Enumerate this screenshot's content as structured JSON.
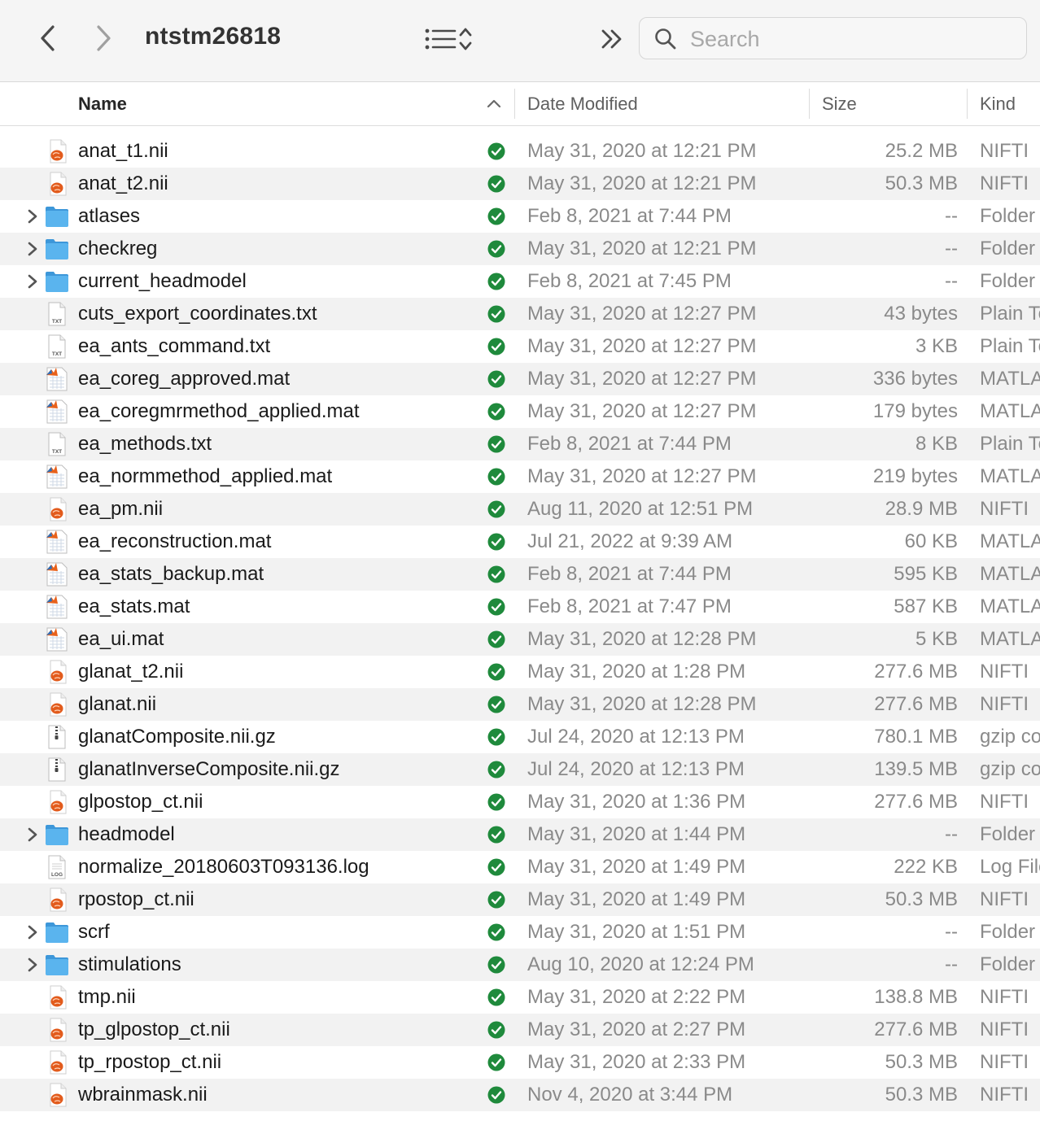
{
  "window": {
    "title": "ntstm26818"
  },
  "search": {
    "placeholder": "Search"
  },
  "columns": {
    "name": "Name",
    "date": "Date Modified",
    "size": "Size",
    "kind": "Kind"
  },
  "colors": {
    "folder": "#5ab4ee",
    "sync": "#1f8a3c",
    "nifti": "#e25b1c"
  },
  "files": [
    {
      "name": "anat_t1.nii",
      "date": "May 31, 2020 at 12:21 PM",
      "size": "25.2 MB",
      "kind": "NIFTI",
      "icon": "nifti-icon",
      "folder": false
    },
    {
      "name": "anat_t2.nii",
      "date": "May 31, 2020 at 12:21 PM",
      "size": "50.3 MB",
      "kind": "NIFTI",
      "icon": "nifti-icon",
      "folder": false
    },
    {
      "name": "atlases",
      "date": "Feb 8, 2021 at 7:44 PM",
      "size": "--",
      "kind": "Folder",
      "icon": "folder-icon",
      "folder": true
    },
    {
      "name": "checkreg",
      "date": "May 31, 2020 at 12:21 PM",
      "size": "--",
      "kind": "Folder",
      "icon": "folder-icon",
      "folder": true
    },
    {
      "name": "current_headmodel",
      "date": "Feb 8, 2021 at 7:45 PM",
      "size": "--",
      "kind": "Folder",
      "icon": "folder-icon",
      "folder": true
    },
    {
      "name": "cuts_export_coordinates.txt",
      "date": "May 31, 2020 at 12:27 PM",
      "size": "43 bytes",
      "kind": "Plain Text",
      "icon": "txt-icon",
      "folder": false
    },
    {
      "name": "ea_ants_command.txt",
      "date": "May 31, 2020 at 12:27 PM",
      "size": "3 KB",
      "kind": "Plain Text",
      "icon": "txt-icon",
      "folder": false
    },
    {
      "name": "ea_coreg_approved.mat",
      "date": "May 31, 2020 at 12:27 PM",
      "size": "336 bytes",
      "kind": "MATLAB",
      "icon": "matlab-icon",
      "folder": false
    },
    {
      "name": "ea_coregmrmethod_applied.mat",
      "date": "May 31, 2020 at 12:27 PM",
      "size": "179 bytes",
      "kind": "MATLAB",
      "icon": "matlab-icon",
      "folder": false
    },
    {
      "name": "ea_methods.txt",
      "date": "Feb 8, 2021 at 7:44 PM",
      "size": "8 KB",
      "kind": "Plain Text",
      "icon": "txt-icon",
      "folder": false
    },
    {
      "name": "ea_normmethod_applied.mat",
      "date": "May 31, 2020 at 12:27 PM",
      "size": "219 bytes",
      "kind": "MATLAB",
      "icon": "matlab-icon",
      "folder": false
    },
    {
      "name": "ea_pm.nii",
      "date": "Aug 11, 2020 at 12:51 PM",
      "size": "28.9 MB",
      "kind": "NIFTI",
      "icon": "nifti-icon",
      "folder": false
    },
    {
      "name": "ea_reconstruction.mat",
      "date": "Jul 21, 2022 at 9:39 AM",
      "size": "60 KB",
      "kind": "MATLAB",
      "icon": "matlab-icon",
      "folder": false
    },
    {
      "name": "ea_stats_backup.mat",
      "date": "Feb 8, 2021 at 7:44 PM",
      "size": "595 KB",
      "kind": "MATLAB",
      "icon": "matlab-icon",
      "folder": false
    },
    {
      "name": "ea_stats.mat",
      "date": "Feb 8, 2021 at 7:47 PM",
      "size": "587 KB",
      "kind": "MATLAB",
      "icon": "matlab-icon",
      "folder": false
    },
    {
      "name": "ea_ui.mat",
      "date": "May 31, 2020 at 12:28 PM",
      "size": "5 KB",
      "kind": "MATLAB",
      "icon": "matlab-icon",
      "folder": false
    },
    {
      "name": "glanat_t2.nii",
      "date": "May 31, 2020 at 1:28 PM",
      "size": "277.6 MB",
      "kind": "NIFTI",
      "icon": "nifti-icon",
      "folder": false
    },
    {
      "name": "glanat.nii",
      "date": "May 31, 2020 at 12:28 PM",
      "size": "277.6 MB",
      "kind": "NIFTI",
      "icon": "nifti-icon",
      "folder": false
    },
    {
      "name": "glanatComposite.nii.gz",
      "date": "Jul 24, 2020 at 12:13 PM",
      "size": "780.1 MB",
      "kind": "gzip compressed",
      "icon": "gzip-icon",
      "folder": false
    },
    {
      "name": "glanatInverseComposite.nii.gz",
      "date": "Jul 24, 2020 at 12:13 PM",
      "size": "139.5 MB",
      "kind": "gzip compressed",
      "icon": "gzip-icon",
      "folder": false
    },
    {
      "name": "glpostop_ct.nii",
      "date": "May 31, 2020 at 1:36 PM",
      "size": "277.6 MB",
      "kind": "NIFTI",
      "icon": "nifti-icon",
      "folder": false
    },
    {
      "name": "headmodel",
      "date": "May 31, 2020 at 1:44 PM",
      "size": "--",
      "kind": "Folder",
      "icon": "folder-icon",
      "folder": true
    },
    {
      "name": "normalize_20180603T093136.log",
      "date": "May 31, 2020 at 1:49 PM",
      "size": "222 KB",
      "kind": "Log File",
      "icon": "log-icon",
      "folder": false
    },
    {
      "name": "rpostop_ct.nii",
      "date": "May 31, 2020 at 1:49 PM",
      "size": "50.3 MB",
      "kind": "NIFTI",
      "icon": "nifti-icon",
      "folder": false
    },
    {
      "name": "scrf",
      "date": "May 31, 2020 at 1:51 PM",
      "size": "--",
      "kind": "Folder",
      "icon": "folder-icon",
      "folder": true
    },
    {
      "name": "stimulations",
      "date": "Aug 10, 2020 at 12:24 PM",
      "size": "--",
      "kind": "Folder",
      "icon": "folder-icon",
      "folder": true
    },
    {
      "name": "tmp.nii",
      "date": "May 31, 2020 at 2:22 PM",
      "size": "138.8 MB",
      "kind": "NIFTI",
      "icon": "nifti-icon",
      "folder": false
    },
    {
      "name": "tp_glpostop_ct.nii",
      "date": "May 31, 2020 at 2:27 PM",
      "size": "277.6 MB",
      "kind": "NIFTI",
      "icon": "nifti-icon",
      "folder": false
    },
    {
      "name": "tp_rpostop_ct.nii",
      "date": "May 31, 2020 at 2:33 PM",
      "size": "50.3 MB",
      "kind": "NIFTI",
      "icon": "nifti-icon",
      "folder": false
    },
    {
      "name": "wbrainmask.nii",
      "date": "Nov 4, 2020 at 3:44 PM",
      "size": "50.3 MB",
      "kind": "NIFTI",
      "icon": "nifti-icon",
      "folder": false
    }
  ]
}
